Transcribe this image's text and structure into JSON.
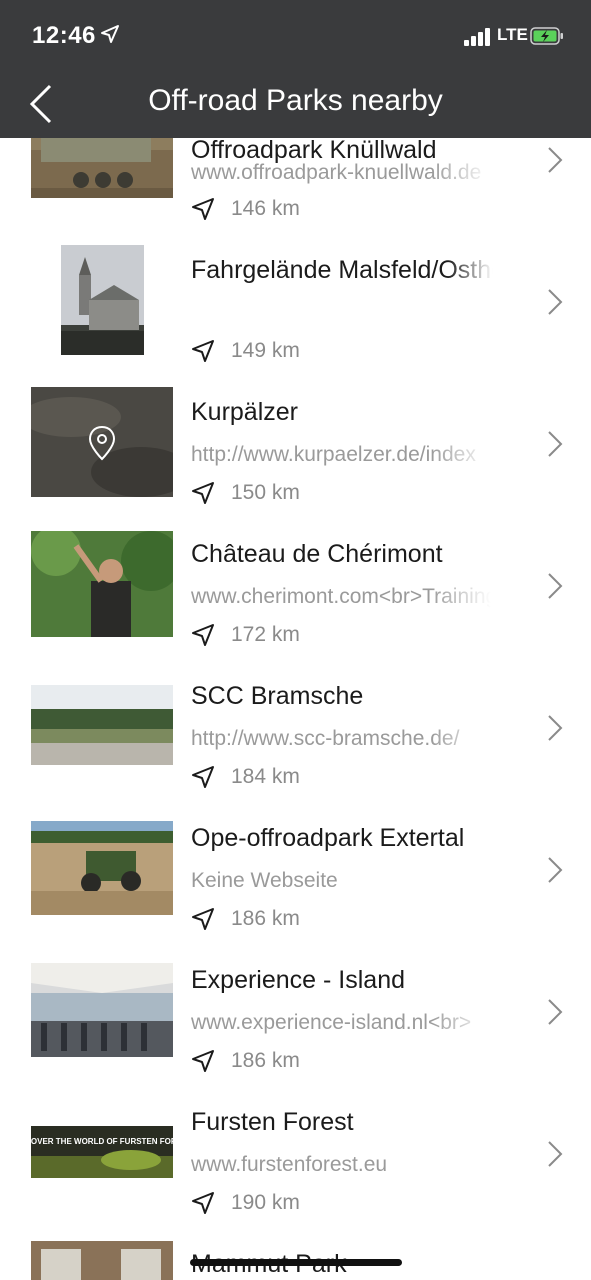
{
  "status_bar": {
    "time": "12:46",
    "network": "LTE"
  },
  "header": {
    "title": "Off-road Parks nearby"
  },
  "parks": [
    {
      "name": "Offroadpark Knüllwald",
      "url": "www.offroadpark-knuellwald.de",
      "distance": "146 km"
    },
    {
      "name": "Fahrgelände Malsfeld/Ostheim",
      "url": "",
      "distance": "149 km"
    },
    {
      "name": "Kurpälzer",
      "url": "http://www.kurpaelzer.de/index",
      "distance": "150 km"
    },
    {
      "name": "Château de Chérimont",
      "url": "www.cherimont.com<br>Training",
      "distance": "172 km"
    },
    {
      "name": "SCC Bramsche",
      "url": "http://www.scc-bramsche.de/",
      "distance": "184 km"
    },
    {
      "name": "Ope-offroadpark Extertal",
      "url": "Keine Webseite",
      "distance": "186 km"
    },
    {
      "name": "Experience - Island",
      "url": "www.experience-island.nl<br>",
      "distance": "186 km"
    },
    {
      "name": "Fursten Forest",
      "url": "www.furstenforest.eu",
      "distance": "190 km"
    },
    {
      "name": "Mammut Park",
      "url": "",
      "distance": ""
    }
  ],
  "thumb_text": {
    "fursten_banner": "DISCOVER THE WORLD OF FURSTEN FOREST"
  },
  "colors": {
    "header_bg": "#3a3b3d",
    "battery": "#5ad15a",
    "text": "#1b1b1b",
    "secondary": "#9a9a9a"
  }
}
